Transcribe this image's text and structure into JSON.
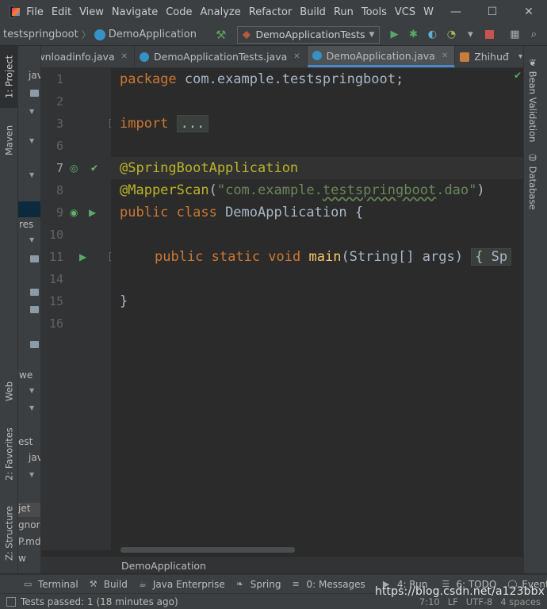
{
  "menu": {
    "items": [
      "File",
      "Edit",
      "View",
      "Navigate",
      "Code",
      "Analyze",
      "Refactor",
      "Build",
      "Run",
      "Tools",
      "VCS",
      "W"
    ],
    "minimize": "—",
    "maximize": "☐",
    "close": "✕"
  },
  "navbar": {
    "project": "testspringboot",
    "file": "DemoApplication",
    "run_config": "DemoApplicationTests"
  },
  "left_tabs": {
    "project": "1: Project",
    "maven": "Maven",
    "web": "Web",
    "favorites": "2: Favorites",
    "structure": "Z: Structure"
  },
  "project_panel": {
    "rows": [
      "jav",
      "",
      "",
      "",
      "",
      "",
      "",
      "",
      "",
      "",
      "res",
      "",
      "",
      "",
      "",
      "",
      "",
      "",
      "",
      "we",
      "",
      "",
      "est",
      "jav",
      "",
      "",
      "jet",
      "gnore",
      "P.md",
      "w"
    ]
  },
  "tabs": [
    {
      "label": "wnloadinfo.java"
    },
    {
      "label": "DemoApplicationTests.java"
    },
    {
      "label": "DemoApplication.java"
    },
    {
      "label": "Zhihuđ"
    }
  ],
  "tabs_overflow": "6",
  "right_tabs": {
    "bean_validation": "Bean Validation",
    "database": "Database"
  },
  "editor": {
    "line_numbers": [
      "1",
      "2",
      "3",
      "6",
      "7",
      "8",
      "9",
      "10",
      "11",
      "14",
      "15",
      "16"
    ],
    "code": {
      "l1_kw": "package",
      "l1_rest": " com.example.testspringboot;",
      "l3_kw": "import",
      "l3_fold": "...",
      "l7_ann": "@SpringBootApplication",
      "l8_ann": "@MapperScan",
      "l8_open": "(",
      "l8_str_a": "\"com.example.",
      "l8_str_b": "testspringboot",
      "l8_str_c": ".dao\"",
      "l8_close": ")",
      "l9_kw": "public class",
      "l9_rest": " DemoApplication {",
      "l11_kw": "public static void",
      "l11_fn": "main",
      "l11_rest": "(String[] args) ",
      "l11_fold": "{ Sp",
      "l15": "}"
    }
  },
  "breadcrumb": "DemoApplication",
  "bottom_tools": [
    {
      "label": "Terminal",
      "icon": "terminal-icon"
    },
    {
      "label": "Build",
      "icon": "hammer-icon"
    },
    {
      "label": "Java Enterprise",
      "icon": "java-enterprise-icon"
    },
    {
      "label": "Spring",
      "icon": "spring-icon"
    },
    {
      "label": "0: Messages",
      "icon": "messages-icon"
    },
    {
      "label": "4: Run",
      "icon": "run-icon"
    },
    {
      "label": "6: TODO",
      "icon": "todo-icon"
    },
    {
      "label": "Event Lo",
      "icon": "event-log-icon"
    }
  ],
  "status": {
    "message": "Tests passed: 1 (18 minutes ago)",
    "position": "7:10",
    "line_sep": "LF",
    "encoding": "UTF-8",
    "indent": "4 spaces"
  },
  "watermark": "https://blog.csdn.net/a123bbx"
}
